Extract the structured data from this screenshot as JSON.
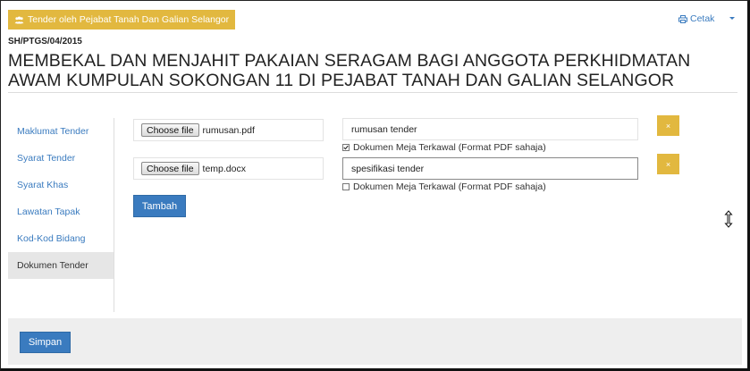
{
  "header": {
    "badge_label": "Tender oleh Pejabat Tanah Dan Galian Selangor",
    "print_label": "Cetak",
    "reference": "SH/PTGS/04/2015",
    "title": "MEMBEKAL DAN MENJAHIT PAKAIAN SERAGAM BAGI ANGGOTA PERKHIDMATAN AWAM KUMPULAN SOKONGAN 11 DI PEJABAT TANAH DAN GALIAN SELANGOR"
  },
  "sidebar": {
    "items": [
      {
        "label": "Maklumat Tender",
        "active": false
      },
      {
        "label": "Syarat Tender",
        "active": false
      },
      {
        "label": "Syarat Khas",
        "active": false
      },
      {
        "label": "Lawatan Tapak",
        "active": false
      },
      {
        "label": "Kod-Kod Bidang",
        "active": false
      },
      {
        "label": "Dokumen Tender",
        "active": true
      }
    ]
  },
  "documents": [
    {
      "choose_label": "Choose file",
      "file_name": "rumusan.pdf",
      "description": "rumusan tender",
      "checkbox_label": "Dokumen Meja Terkawal (Format PDF sahaja)",
      "checked": true,
      "delete_label": "×"
    },
    {
      "choose_label": "Choose file",
      "file_name": "temp.docx",
      "description": "spesifikasi tender",
      "checkbox_label": "Dokumen Meja Terkawal (Format PDF sahaja)",
      "checked": false,
      "delete_label": "×"
    }
  ],
  "actions": {
    "add_label": "Tambah",
    "save_label": "Simpan"
  },
  "colors": {
    "accent_blue": "#3a7bbf",
    "accent_gold": "#e2b83f"
  }
}
